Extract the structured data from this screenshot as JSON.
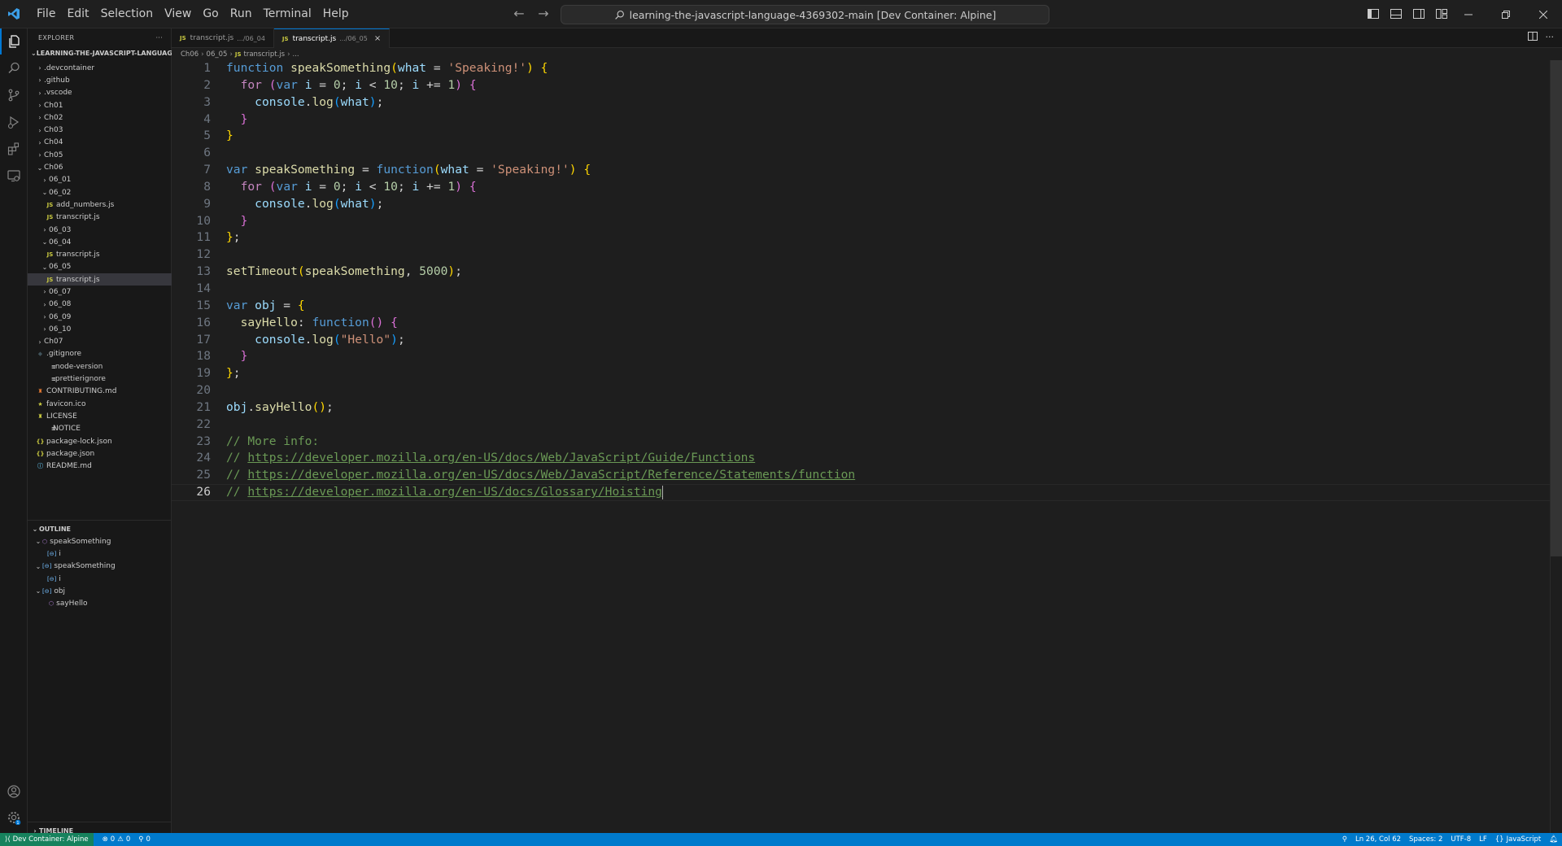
{
  "menu": [
    "File",
    "Edit",
    "Selection",
    "View",
    "Go",
    "Run",
    "Terminal",
    "Help"
  ],
  "command_center": {
    "text": "learning-the-javascript-language-4369302-main [Dev Container: Alpine]"
  },
  "explorer": {
    "header": "EXPLORER",
    "more": "···",
    "root": "LEARNING-THE-JAVASCRIPT-LANGUAGE-4...",
    "items": [
      {
        "label": ".devcontainer"
      },
      {
        "label": ".github"
      },
      {
        "label": ".vscode"
      },
      {
        "label": "Ch01"
      },
      {
        "label": "Ch02"
      },
      {
        "label": "Ch03"
      },
      {
        "label": "Ch04"
      },
      {
        "label": "Ch05"
      },
      {
        "label": "Ch06"
      },
      {
        "label": "06_01"
      },
      {
        "label": "06_02"
      },
      {
        "label": "add_numbers.js"
      },
      {
        "label": "transcript.js"
      },
      {
        "label": "06_03"
      },
      {
        "label": "06_04"
      },
      {
        "label": "transcript.js"
      },
      {
        "label": "06_05"
      },
      {
        "label": "transcript.js"
      },
      {
        "label": "06_07"
      },
      {
        "label": "06_08"
      },
      {
        "label": "06_09"
      },
      {
        "label": "06_10"
      },
      {
        "label": "Ch07"
      },
      {
        "label": ".gitignore"
      },
      {
        "label": ".node-version"
      },
      {
        "label": ".prettierignore"
      },
      {
        "label": "CONTRIBUTING.md"
      },
      {
        "label": "favicon.ico"
      },
      {
        "label": "LICENSE"
      },
      {
        "label": "NOTICE"
      },
      {
        "label": "package-lock.json"
      },
      {
        "label": "package.json"
      },
      {
        "label": "README.md"
      }
    ]
  },
  "outline": {
    "header": "OUTLINE",
    "items": [
      {
        "label": "speakSomething"
      },
      {
        "label": "i"
      },
      {
        "label": "speakSomething"
      },
      {
        "label": "i"
      },
      {
        "label": "obj"
      },
      {
        "label": "sayHello"
      }
    ]
  },
  "timeline": {
    "header": "TIMELINE"
  },
  "tabs": [
    {
      "label": "transcript.js",
      "desc": ".../06_04"
    },
    {
      "label": "transcript.js",
      "desc": ".../06_05",
      "close": "×"
    }
  ],
  "breadcrumbs": [
    "Ch06",
    "06_05",
    "transcript.js",
    "..."
  ],
  "code_lines": [
    {
      "n": "1"
    },
    {
      "n": "2"
    },
    {
      "n": "3"
    },
    {
      "n": "4"
    },
    {
      "n": "5"
    },
    {
      "n": "6"
    },
    {
      "n": "7"
    },
    {
      "n": "8"
    },
    {
      "n": "9"
    },
    {
      "n": "10"
    },
    {
      "n": "11"
    },
    {
      "n": "12"
    },
    {
      "n": "13"
    },
    {
      "n": "14"
    },
    {
      "n": "15"
    },
    {
      "n": "16"
    },
    {
      "n": "17"
    },
    {
      "n": "18"
    },
    {
      "n": "19"
    },
    {
      "n": "20"
    },
    {
      "n": "21"
    },
    {
      "n": "22"
    },
    {
      "n": "23"
    },
    {
      "n": "24"
    },
    {
      "n": "25"
    },
    {
      "n": "26"
    }
  ],
  "code": {
    "l1": {
      "kw": "function",
      "name": "speakSomething",
      "p1": "(",
      "param": "what",
      "eq": " = ",
      "str": "'Speaking!'",
      "p2": ")",
      "br": "{"
    },
    "l2": {
      "kw": "for",
      "p1": "(",
      "kw2": "var",
      "v": "i",
      "rest1": " = ",
      "n0": "0",
      "rest2": "; ",
      "v2": "i",
      "rest3": " < ",
      "n10": "10",
      "rest4": "; ",
      "v3": "i",
      "rest5": " += ",
      "n1": "1",
      "p2": ")",
      "br": "{"
    },
    "l3": {
      "obj": "console",
      "dot": ".",
      "fn": "log",
      "p1": "(",
      "arg": "what",
      "p2": ")",
      "semi": ";"
    },
    "l4": {
      "br": "}"
    },
    "l5": {
      "br": "}"
    },
    "l7": {
      "kw": "var",
      "name": "speakSomething",
      "eq": " = ",
      "kw2": "function",
      "p1": "(",
      "param": "what",
      "eq2": " = ",
      "str": "'Speaking!'",
      "p2": ")",
      "br": "{"
    },
    "l8": {
      "kw": "for",
      "p1": "(",
      "kw2": "var",
      "v": "i",
      "rest1": " = ",
      "n0": "0",
      "rest2": "; ",
      "v2": "i",
      "rest3": " < ",
      "n10": "10",
      "rest4": "; ",
      "v3": "i",
      "rest5": " += ",
      "n1": "1",
      "p2": ")",
      "br": "{"
    },
    "l9": {
      "obj": "console",
      "dot": ".",
      "fn": "log",
      "p1": "(",
      "arg": "what",
      "p2": ")",
      "semi": ";"
    },
    "l10": {
      "br": "}"
    },
    "l11": {
      "br": "}",
      "semi": ";"
    },
    "l13": {
      "fn": "setTimeout",
      "p1": "(",
      "arg": "speakSomething",
      "comma": ", ",
      "num": "5000",
      "p2": ")",
      "semi": ";"
    },
    "l15": {
      "kw": "var",
      "name": "obj",
      "eq": " = ",
      "br": "{"
    },
    "l16": {
      "prop": "sayHello",
      "colon": ": ",
      "kw": "function",
      "p": "()",
      "br": "{"
    },
    "l17": {
      "obj": "console",
      "dot": ".",
      "fn": "log",
      "p1": "(",
      "str": "\"Hello\"",
      "p2": ")",
      "semi": ";"
    },
    "l18": {
      "br": "}"
    },
    "l19": {
      "br": "}",
      "semi": ";"
    },
    "l21": {
      "obj": "obj",
      "dot": ".",
      "fn": "sayHello",
      "p": "()",
      "semi": ";"
    },
    "l23": {
      "com": "// More info:"
    },
    "l24": {
      "pre": "// ",
      "url": "https://developer.mozilla.org/en-US/docs/Web/JavaScript/Guide/Functions"
    },
    "l25": {
      "pre": "// ",
      "url": "https://developer.mozilla.org/en-US/docs/Web/JavaScript/Reference/Statements/function"
    },
    "l26": {
      "pre": "// ",
      "url": "https://developer.mozilla.org/en-US/docs/Glossary/Hoisting"
    }
  },
  "status": {
    "remote": "Dev Container: Alpine",
    "errors": "0",
    "warnings": "0",
    "ports": "0",
    "position": "Ln 26, Col 62",
    "spaces": "Spaces: 2",
    "encoding": "UTF-8",
    "eol": "LF",
    "language": "JavaScript"
  },
  "colors": {
    "accent": "#0078d4",
    "statusbar": "#007acc",
    "remote": "#16825d"
  }
}
